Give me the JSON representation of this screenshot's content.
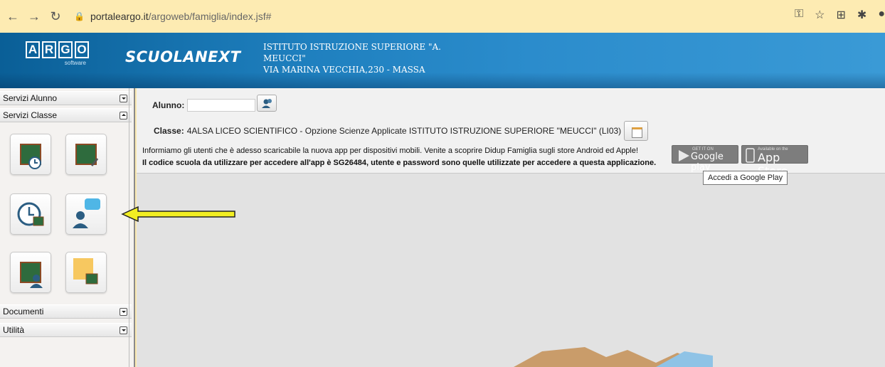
{
  "browser": {
    "url_domain": "portaleargo.it",
    "url_path": "/argoweb/famiglia/index.jsf#"
  },
  "banner": {
    "argo_letters": [
      "A",
      "R",
      "G",
      "O"
    ],
    "argo_sub": "software",
    "scuolanext": "SCUOLANEXT",
    "school_line1": "ISTITUTO ISTRUZIONE SUPERIORE \"A.",
    "school_line2": "MEUCCI\"",
    "school_line3": "VIA MARINA VECCHIA,230 - MASSA"
  },
  "sidebar": {
    "sections": [
      "Servizi Alunno",
      "Servizi Classe",
      "Documenti",
      "Utilità"
    ]
  },
  "main": {
    "alunno_label": "Alunno:",
    "classe_label": "Classe:",
    "classe_value": "4ALSA LICEO SCIENTIFICO - Opzione Scienze Applicate ISTITUTO ISTRUZIONE SUPERIORE \"MEUCCI\" (LI03)",
    "info_line1": "Informiamo gli utenti che è adesso scaricabile la nuova app per dispositivi mobili. Venite a scoprire Didup Famiglia sugli store Android ed Apple!",
    "info_line2": "Il codice scuola da utilizzare per accedere all'app è SG26484, utente e password sono quelle utilizzate per accedere a questa applicazione.",
    "google_play_small": "GET IT ON",
    "google_play": "Google play",
    "app_store_small": "Available on the",
    "app_store": "App Store",
    "tooltip": "Accedi a Google Play"
  },
  "colors": {
    "page_bg": "#fbe9b0",
    "banner": "#1f80bf",
    "arrow": "#f2ee22"
  }
}
